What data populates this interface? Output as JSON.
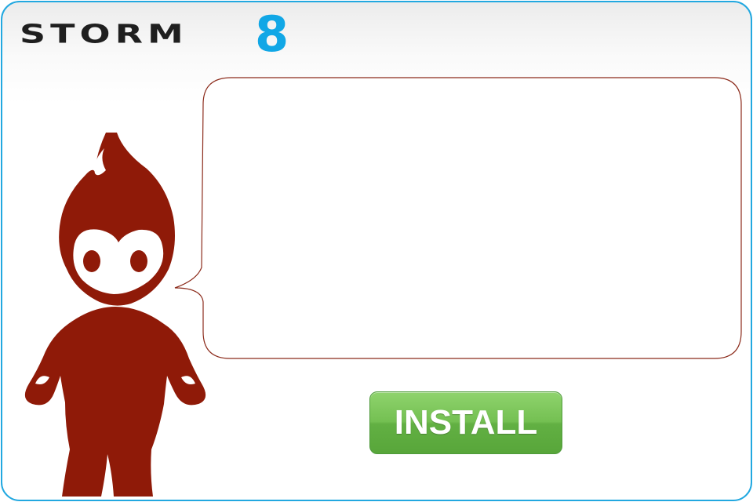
{
  "brand": {
    "wordmark": "STORM",
    "digit": "8",
    "wordmark_color": "#1f1f1f",
    "digit_color": "#11a7e6"
  },
  "mascot": {
    "icon": "flame-mascot-icon",
    "color": "#8f1a08"
  },
  "speech_bubble": {
    "text": "",
    "border_color": "#8b2a1a"
  },
  "install_button": {
    "label": "INSTALL",
    "color": "#6dbb4e"
  },
  "frame": {
    "border_color": "#22a8e0"
  }
}
